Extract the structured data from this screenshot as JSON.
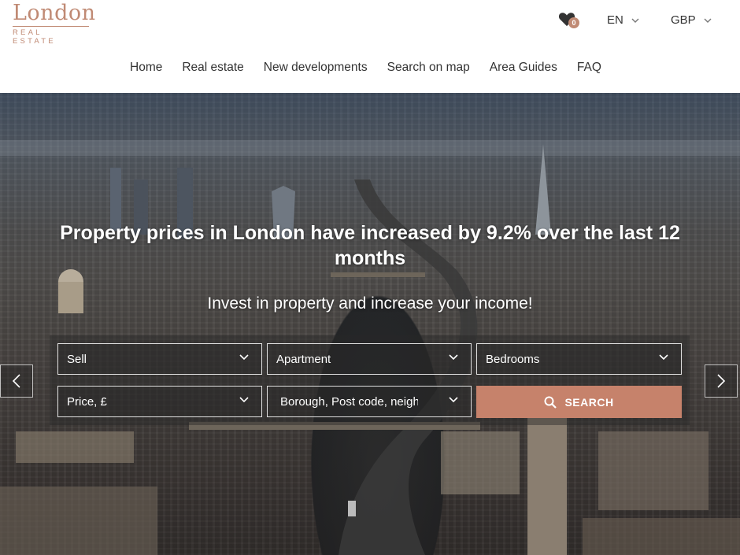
{
  "logo": {
    "main": "London",
    "sub": "REAL ESTATE"
  },
  "header": {
    "favorites_count": "0",
    "language": "EN",
    "currency": "GBP"
  },
  "nav": [
    "Home",
    "Real estate",
    "New developments",
    "Search on map",
    "Area Guides",
    "FAQ"
  ],
  "hero": {
    "title_line1": "Property prices in London have increased by 9.2% over the last 12",
    "title_line2": "months",
    "subtitle": "Invest in property and increase your income!"
  },
  "search": {
    "deal_type": "Sell",
    "property_type": "Apartment",
    "bedrooms": "Bedrooms",
    "price": "Price, £",
    "location_placeholder": "Borough, Post code, neighbourhood",
    "button": "SEARCH"
  },
  "colors": {
    "accent": "#c6826b",
    "logo": "#c08a74"
  },
  "icons": {
    "favorites": "heart-icon",
    "chevron": "chevron-down-icon",
    "search": "search-icon",
    "prev": "chevron-left-icon",
    "next": "chevron-right-icon"
  }
}
